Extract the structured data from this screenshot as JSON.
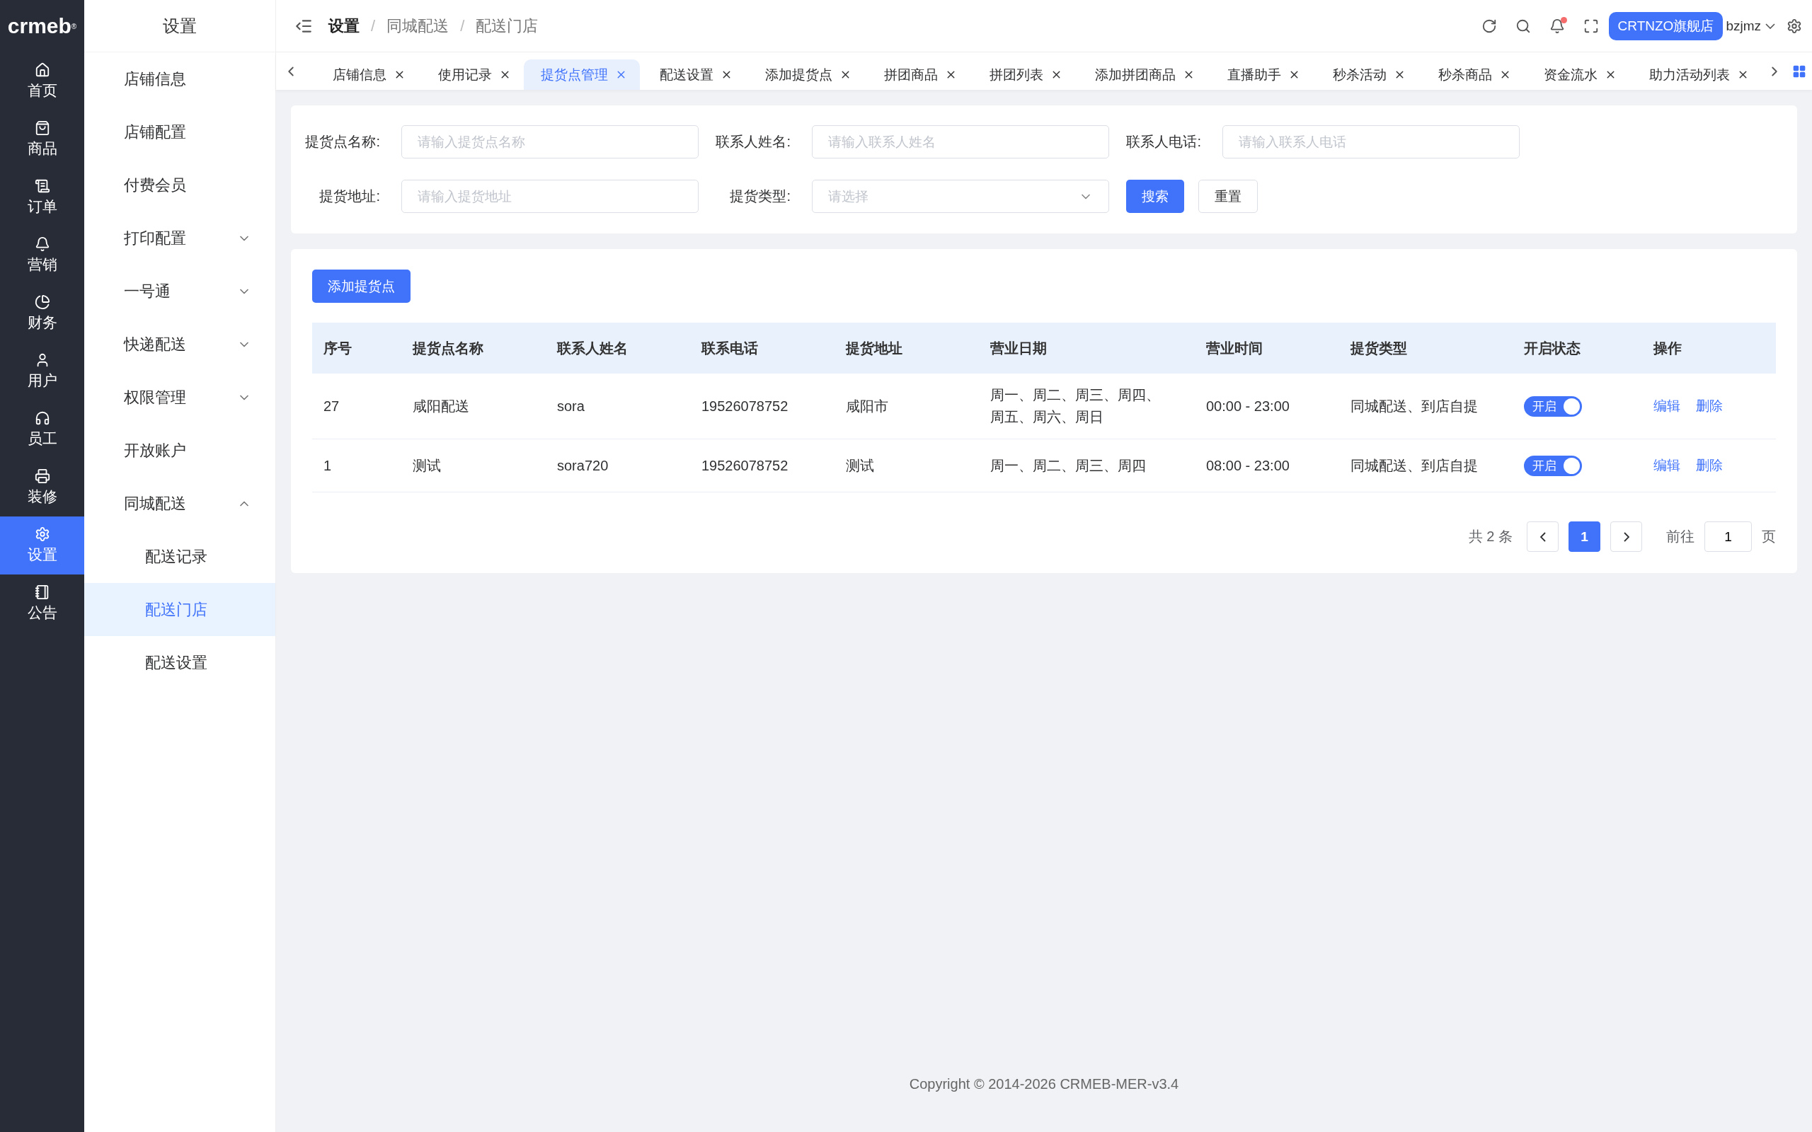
{
  "logo": "crmeb$^{®}$",
  "rail": [
    {
      "label": "首页",
      "selected": false
    },
    {
      "label": "商品",
      "selected": false
    },
    {
      "label": "订单",
      "selected": false
    },
    {
      "label": "营销",
      "selected": false
    },
    {
      "label": "财务",
      "selected": false
    },
    {
      "label": "用户",
      "selected": false
    },
    {
      "label": "员工",
      "selected": false
    },
    {
      "label": "装修",
      "selected": false
    },
    {
      "label": "设置",
      "selected": true
    },
    {
      "label": "公告",
      "selected": false
    }
  ],
  "submenu": {
    "title": "设置",
    "items": [
      {
        "label": "店铺信息",
        "selected": false
      },
      {
        "label": "店铺配置",
        "selected": false
      },
      {
        "label": "付费会员",
        "selected": false
      },
      {
        "label": "打印配置",
        "selected": false,
        "expanded": false
      },
      {
        "label": "一号通",
        "selected": false,
        "expanded": false
      },
      {
        "label": "快递配送",
        "selected": false,
        "expanded": false
      },
      {
        "label": "权限管理",
        "selected": false,
        "expanded": false
      },
      {
        "label": "开放账户",
        "selected": false
      },
      {
        "label": "同城配送",
        "selected": false,
        "expanded": true,
        "children": [
          {
            "label": "配送记录",
            "selected": false
          },
          {
            "label": "配送门店",
            "selected": true
          },
          {
            "label": "配送设置",
            "selected": false
          }
        ]
      }
    ]
  },
  "breadcrumb": [
    "设置",
    "同城配送",
    "配送门店"
  ],
  "breadcrumb_separator": "/",
  "header": {
    "notification_dot": true,
    "store_button": "CRTNZO旗舰店",
    "user": "bzjmz"
  },
  "tabs": [
    {
      "label": "店铺信息",
      "selected": false
    },
    {
      "label": "使用记录",
      "selected": false
    },
    {
      "label": "提货点管理",
      "selected": true
    },
    {
      "label": "配送设置",
      "selected": false
    },
    {
      "label": "添加提货点",
      "selected": false
    },
    {
      "label": "拼团商品",
      "selected": false
    },
    {
      "label": "拼团列表",
      "selected": false
    },
    {
      "label": "添加拼团商品",
      "selected": false
    },
    {
      "label": "直播助手",
      "selected": false
    },
    {
      "label": "秒杀活动",
      "selected": false
    },
    {
      "label": "秒杀商品",
      "selected": false
    },
    {
      "label": "资金流水",
      "selected": false
    },
    {
      "label": "助力活动列表",
      "selected": false
    }
  ],
  "search": {
    "fields": [
      {
        "kind": "input",
        "label": "提货点名称:",
        "placeholder": "请输入提货点名称"
      },
      {
        "kind": "input",
        "label": "联系人姓名:",
        "placeholder": "请输入联系人姓名"
      },
      {
        "kind": "input",
        "label": "联系人电话:",
        "placeholder": "请输入联系人电话"
      },
      {
        "kind": "input",
        "label": "提货地址:",
        "placeholder": "请输入提货地址"
      },
      {
        "kind": "select",
        "label": "提货类型:",
        "placeholder": "请选择"
      }
    ],
    "search_button": "搜索",
    "reset_button": "重置"
  },
  "add_button": "添加提货点",
  "table": {
    "columns": [
      "序号",
      "提货点名称",
      "联系人姓名",
      "联系电话",
      "提货地址",
      "营业日期",
      "营业时间",
      "提货类型",
      "开启状态",
      "操作"
    ],
    "rows": [
      {
        "cells": [
          "27",
          "咸阳配送",
          "sora",
          "19526078752",
          "咸阳市",
          "周一、周二、周三、周四、周五、周六、周日",
          "00:00 - 23:00",
          "同城配送、到店自提"
        ],
        "on": true,
        "switch_label": "开启",
        "actions": [
          "编辑",
          "删除"
        ]
      },
      {
        "cells": [
          "1",
          "测试",
          "sora720",
          "19526078752",
          "测试",
          "周一、周二、周三、周四",
          "08:00 - 23:00",
          "同城配送、到店自提"
        ],
        "on": true,
        "switch_label": "开启",
        "actions": [
          "编辑",
          "删除"
        ]
      }
    ]
  },
  "pagination": {
    "total": "共 2 条",
    "pages": [
      {
        "label": "1",
        "selected": true
      }
    ],
    "goto_label": "前往",
    "goto_value": "1",
    "page_suffix": "页"
  },
  "footer": "Copyright © 2014-2026 CRMEB-MER-v3.4"
}
